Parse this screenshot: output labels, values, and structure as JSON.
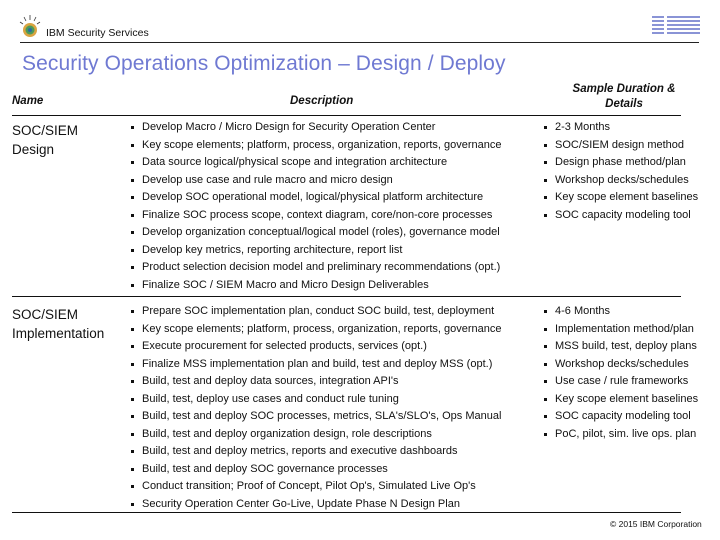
{
  "header": {
    "brand": "IBM Security Services",
    "logo_icon": "ibm-security-globe-icon",
    "ibm_logo_icon": "ibm-striped-logo-icon",
    "title": "Security Operations Optimization – Design / Deploy"
  },
  "table": {
    "columns": {
      "name": "Name",
      "description": "Description",
      "duration": "Sample Duration & Details"
    },
    "rows": [
      {
        "name": "SOC/SIEM\nDesign",
        "description": [
          "Develop Macro / Micro Design for Security Operation Center",
          "Key scope elements; platform, process, organization, reports, governance",
          "Data source logical/physical scope and integration architecture",
          "Develop use case and rule macro and micro design",
          "Develop SOC operational model, logical/physical platform architecture",
          "Finalize SOC process scope, context diagram, core/non-core processes",
          "Develop organization conceptual/logical model (roles), governance model",
          "Develop key metrics, reporting architecture, report list",
          "Product selection decision model and preliminary recommendations (opt.)",
          "Finalize SOC / SIEM Macro and Micro Design Deliverables"
        ],
        "details": [
          "2-3 Months",
          "SOC/SIEM design method",
          "Design phase method/plan",
          "Workshop decks/schedules",
          "Key scope element baselines",
          "SOC capacity modeling tool"
        ]
      },
      {
        "name": "SOC/SIEM\nImplementation",
        "description": [
          "Prepare SOC implementation plan, conduct SOC build, test, deployment",
          "Key scope elements; platform, process, organization, reports, governance",
          "Execute procurement for selected products, services (opt.)",
          "Finalize MSS implementation plan and build, test and deploy MSS (opt.)",
          "Build, test and deploy data sources, integration API's",
          "Build, test, deploy use cases and conduct rule tuning",
          "Build, test and deploy SOC processes, metrics, SLA's/SLO's, Ops Manual",
          "Build, test and deploy organization design, role descriptions",
          "Build, test and deploy metrics, reports and executive dashboards",
          "Build, test and deploy SOC governance processes",
          "Conduct transition; Proof of Concept, Pilot Op's, Simulated Live Op's",
          "Security Operation Center Go-Live, Update Phase N Design Plan"
        ],
        "details": [
          "4-6 Months",
          "Implementation method/plan",
          "MSS build, test, deploy plans",
          "Workshop decks/schedules",
          "Use case / rule frameworks",
          "Key scope element baselines",
          "SOC capacity modeling tool",
          "PoC, pilot, sim. live ops. plan"
        ]
      }
    ]
  },
  "footer": {
    "copyright": "© 2015 IBM Corporation"
  },
  "colors": {
    "title": "#6f79d2",
    "ibm_logo": "#8a94d6"
  }
}
